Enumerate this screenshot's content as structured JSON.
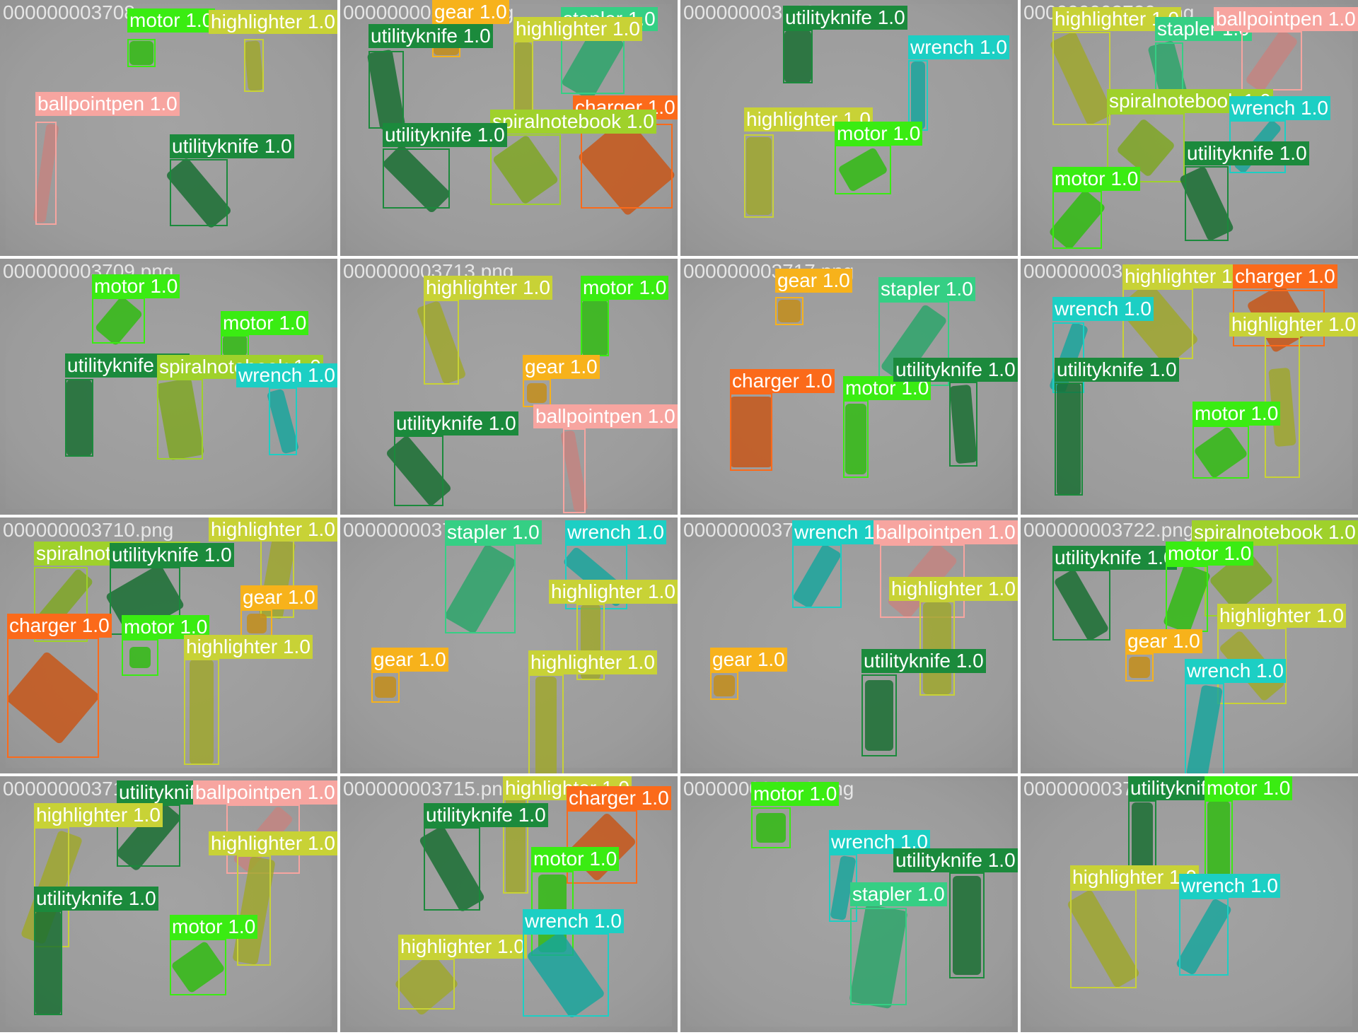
{
  "colors": {
    "motor": "#3aec12",
    "highlighter": "#c8d236",
    "utilityknife": "#1b8a3c",
    "ballpointpen": "#f7a5a0",
    "gear": "#f7b21b",
    "stapler": "#35cf84",
    "charger": "#fb6a1a",
    "spiralnotebook": "#9fd12b",
    "wrench": "#1ccfc4"
  },
  "tiles": [
    {
      "filename": "000000003708.png",
      "detections": [
        {
          "cls": "motor",
          "label": "motor 1.0"
        },
        {
          "cls": "highlighter",
          "label": "highlighter 1.0"
        },
        {
          "cls": "ballpointpen",
          "label": "ballpointpen 1.0"
        },
        {
          "cls": "utilityknife",
          "label": "utilityknife 1.0"
        }
      ]
    },
    {
      "filename": "000000003712.png",
      "detections": [
        {
          "cls": "gear",
          "label": "gear 1.0"
        },
        {
          "cls": "stapler",
          "label": "stapler 1.0"
        },
        {
          "cls": "utilityknife",
          "label": "utilityknife 1.0"
        },
        {
          "cls": "highlighter",
          "label": "highlighter 1.0"
        },
        {
          "cls": "charger",
          "label": "charger 1.0"
        },
        {
          "cls": "spiralnotebook",
          "label": "spiralnotebook 1.0"
        },
        {
          "cls": "utilityknife",
          "label": "utilityknife 1.0"
        }
      ]
    },
    {
      "filename": "000000003716.png",
      "detections": [
        {
          "cls": "utilityknife",
          "label": "utilityknife 1.0"
        },
        {
          "cls": "wrench",
          "label": "wrench 1.0"
        },
        {
          "cls": "highlighter",
          "label": "highlighter 1.0"
        },
        {
          "cls": "motor",
          "label": "motor 1.0"
        }
      ]
    },
    {
      "filename": "000000003720.png",
      "detections": [
        {
          "cls": "highlighter",
          "label": "highlighter 1.0"
        },
        {
          "cls": "stapler",
          "label": "stapler 1.0"
        },
        {
          "cls": "ballpointpen",
          "label": "ballpointpen 1.0"
        },
        {
          "cls": "spiralnotebook",
          "label": "spiralnotebook 1.0"
        },
        {
          "cls": "wrench",
          "label": "wrench 1.0"
        },
        {
          "cls": "utilityknife",
          "label": "utilityknife 1.0"
        },
        {
          "cls": "motor",
          "label": "motor 1.0"
        }
      ]
    },
    {
      "filename": "000000003709.png",
      "detections": [
        {
          "cls": "motor",
          "label": "motor 1.0"
        },
        {
          "cls": "motor",
          "label": "motor 1.0"
        },
        {
          "cls": "utilityknife",
          "label": "utilityknife 1.0"
        },
        {
          "cls": "spiralnotebook",
          "label": "spiralnotebook 1.0"
        },
        {
          "cls": "wrench",
          "label": "wrench 1.0"
        }
      ]
    },
    {
      "filename": "000000003713.png",
      "detections": [
        {
          "cls": "highlighter",
          "label": "highlighter 1.0"
        },
        {
          "cls": "motor",
          "label": "motor 1.0"
        },
        {
          "cls": "gear",
          "label": "gear 1.0"
        },
        {
          "cls": "utilityknife",
          "label": "utilityknife 1.0"
        },
        {
          "cls": "ballpointpen",
          "label": "ballpointpen 1.0"
        }
      ]
    },
    {
      "filename": "000000003717.png",
      "detections": [
        {
          "cls": "gear",
          "label": "gear 1.0"
        },
        {
          "cls": "stapler",
          "label": "stapler 1.0"
        },
        {
          "cls": "charger",
          "label": "charger 1.0"
        },
        {
          "cls": "motor",
          "label": "motor 1.0"
        },
        {
          "cls": "utilityknife",
          "label": "utilityknife 1.0"
        }
      ]
    },
    {
      "filename": "000000003721.png",
      "detections": [
        {
          "cls": "highlighter",
          "label": "highlighter 1.0"
        },
        {
          "cls": "charger",
          "label": "charger 1.0"
        },
        {
          "cls": "wrench",
          "label": "wrench 1.0"
        },
        {
          "cls": "highlighter",
          "label": "highlighter 1.0"
        },
        {
          "cls": "utilityknife",
          "label": "utilityknife 1.0"
        },
        {
          "cls": "motor",
          "label": "motor 1.0"
        }
      ]
    },
    {
      "filename": "000000003710.png",
      "detections": [
        {
          "cls": "spiralnotebook",
          "label": "spiralnotebook 1.0"
        },
        {
          "cls": "highlighter",
          "label": "highlighter 1.0"
        },
        {
          "cls": "utilityknife",
          "label": "utilityknife 1.0"
        },
        {
          "cls": "gear",
          "label": "gear 1.0"
        },
        {
          "cls": "charger",
          "label": "charger 1.0"
        },
        {
          "cls": "motor",
          "label": "motor 1.0"
        },
        {
          "cls": "highlighter",
          "label": "highlighter 1.0"
        }
      ]
    },
    {
      "filename": "000000003714.png",
      "detections": [
        {
          "cls": "stapler",
          "label": "stapler 1.0"
        },
        {
          "cls": "wrench",
          "label": "wrench 1.0"
        },
        {
          "cls": "highlighter",
          "label": "highlighter 1.0"
        },
        {
          "cls": "gear",
          "label": "gear 1.0"
        },
        {
          "cls": "highlighter",
          "label": "highlighter 1.0"
        }
      ]
    },
    {
      "filename": "000000003718.png",
      "detections": [
        {
          "cls": "wrench",
          "label": "wrench 1.0"
        },
        {
          "cls": "ballpointpen",
          "label": "ballpointpen 1.0"
        },
        {
          "cls": "highlighter",
          "label": "highlighter 1.0"
        },
        {
          "cls": "gear",
          "label": "gear 1.0"
        },
        {
          "cls": "utilityknife",
          "label": "utilityknife 1.0"
        }
      ]
    },
    {
      "filename": "000000003722.png",
      "detections": [
        {
          "cls": "spiralnotebook",
          "label": "spiralnotebook 1.0"
        },
        {
          "cls": "utilityknife",
          "label": "utilityknife 1.0"
        },
        {
          "cls": "motor",
          "label": "motor 1.0"
        },
        {
          "cls": "highlighter",
          "label": "highlighter 1.0"
        },
        {
          "cls": "gear",
          "label": "gear 1.0"
        },
        {
          "cls": "wrench",
          "label": "wrench 1.0"
        }
      ]
    },
    {
      "filename": "000000003711.png",
      "detections": [
        {
          "cls": "utilityknife",
          "label": "utilityknife 1.0"
        },
        {
          "cls": "ballpointpen",
          "label": "ballpointpen 1.0"
        },
        {
          "cls": "highlighter",
          "label": "highlighter 1.0"
        },
        {
          "cls": "highlighter",
          "label": "highlighter 1.0"
        },
        {
          "cls": "utilityknife",
          "label": "utilityknife 1.0"
        },
        {
          "cls": "motor",
          "label": "motor 1.0"
        }
      ]
    },
    {
      "filename": "000000003715.png",
      "detections": [
        {
          "cls": "highlighter",
          "label": "highlighter 1.0"
        },
        {
          "cls": "charger",
          "label": "charger 1.0"
        },
        {
          "cls": "utilityknife",
          "label": "utilityknife 1.0"
        },
        {
          "cls": "motor",
          "label": "motor 1.0"
        },
        {
          "cls": "highlighter",
          "label": "highlighter 1.0"
        },
        {
          "cls": "wrench",
          "label": "wrench 1.0"
        }
      ]
    },
    {
      "filename": "000000003719.png",
      "detections": [
        {
          "cls": "motor",
          "label": "motor 1.0"
        },
        {
          "cls": "wrench",
          "label": "wrench 1.0"
        },
        {
          "cls": "utilityknife",
          "label": "utilityknife 1.0"
        },
        {
          "cls": "stapler",
          "label": "stapler 1.0"
        }
      ]
    },
    {
      "filename": "000000003724.png",
      "detections": [
        {
          "cls": "utilityknife",
          "label": "utilityknife 1.0"
        },
        {
          "cls": "motor",
          "label": "motor 1.0"
        },
        {
          "cls": "highlighter",
          "label": "highlighter 1.0"
        },
        {
          "cls": "wrench",
          "label": "wrench 1.0"
        }
      ]
    }
  ]
}
